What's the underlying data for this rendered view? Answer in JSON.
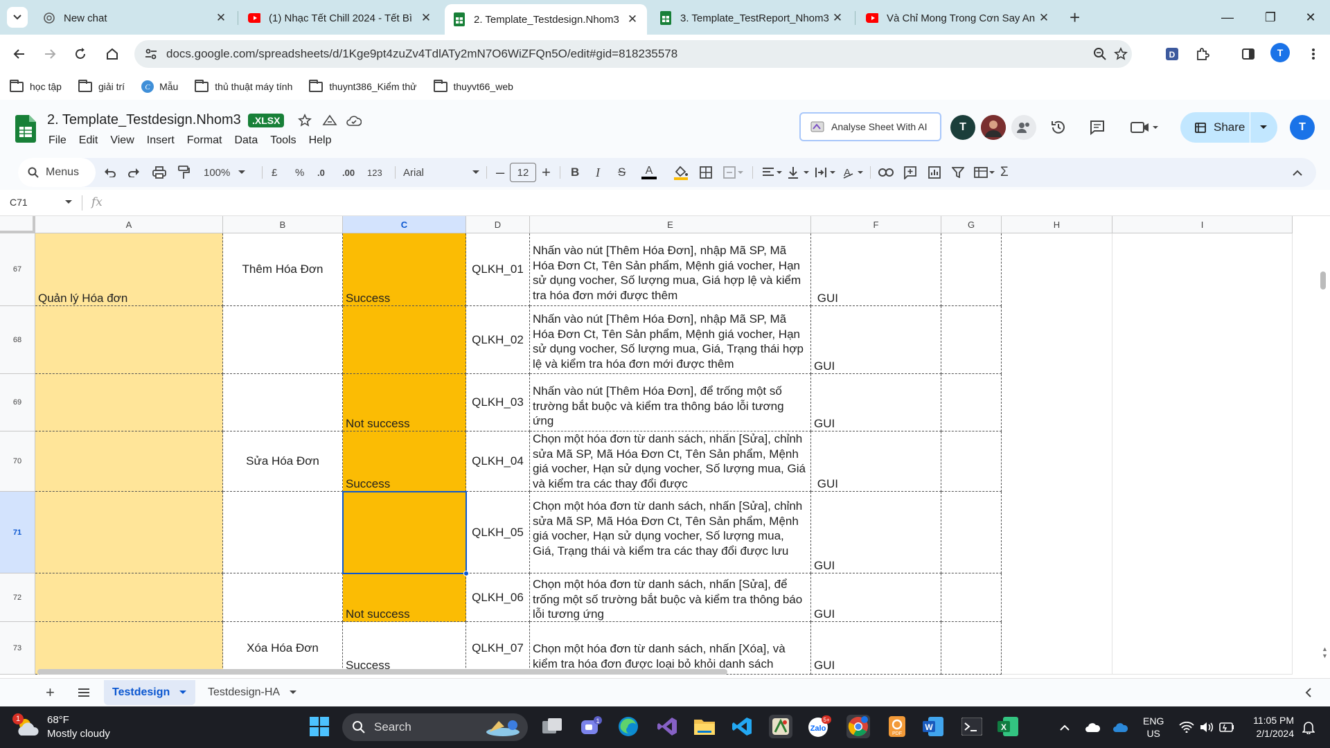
{
  "browser": {
    "tabs": [
      {
        "title": "New chat",
        "icon": "chat-icon"
      },
      {
        "title": "(1) Nhạc Tết Chill 2024 - Tết Bì",
        "icon": "youtube-icon"
      },
      {
        "title": "2. Template_Testdesign.Nhom3",
        "icon": "sheets-icon",
        "active": true
      },
      {
        "title": "3. Template_TestReport_Nhom3",
        "icon": "sheets-icon"
      },
      {
        "title": "Và Chỉ Mong Trong Cơn Say An",
        "icon": "youtube-icon"
      }
    ],
    "url": "docs.google.com/spreadsheets/d/1Kge9pt4zuZv4TdlATy2mN7O6WiZFQn5O/edit#gid=818235578",
    "bookmarks": [
      "học tập",
      "giải trí",
      "Mẫu",
      "thủ thuật máy tính",
      "thuynt386_Kiểm thử",
      "thuyvt66_web"
    ],
    "profile_initial": "T"
  },
  "sheets": {
    "doc_title": "2. Template_Testdesign.Nhom3",
    "file_badge": ".XLSX",
    "menu": [
      "File",
      "Edit",
      "View",
      "Insert",
      "Format",
      "Data",
      "Tools",
      "Help"
    ],
    "ai_button": "Analyse Sheet With AI",
    "share_label": "Share",
    "avatar_initial": "T",
    "toolbar": {
      "menus_label": "Menus",
      "zoom": "100%",
      "currency": "£",
      "percent": "%",
      "dec_decrease": ".0",
      "dec_increase": ".00",
      "number_format": "123",
      "font": "Arial",
      "font_size": "12"
    },
    "name_box": "C71",
    "fx_label": "fx",
    "columns": [
      "A",
      "B",
      "C",
      "D",
      "E",
      "F",
      "G",
      "H",
      "I"
    ],
    "selected_column": "C",
    "selected_row": "71",
    "rows": [
      {
        "num": "67",
        "a": "Quản lý Hóa đơn",
        "b": "Thêm Hóa Đơn",
        "c": "Success",
        "d": "QLKH_01",
        "e": "Nhấn vào nút [Thêm Hóa Đơn], nhập Mã SP, Mã Hóa Đơn Ct, Tên Sản phẩm, Mệnh giá vocher, Hạn sử dụng vocher, Số lượng mua, Giá hợp lệ và kiểm tra hóa đơn mới được thêm",
        "f": " GUI"
      },
      {
        "num": "68",
        "a": "",
        "b": "",
        "c": "",
        "d": "QLKH_02",
        "e": "Nhấn vào nút [Thêm Hóa Đơn], nhập Mã SP, Mã Hóa Đơn Ct, Tên Sản phẩm, Mệnh giá vocher, Hạn sử dụng vocher, Số lượng mua, Giá, Trạng thái hợp lệ và kiểm tra hóa đơn mới được thêm",
        "f": "GUI"
      },
      {
        "num": "69",
        "a": "",
        "b": "",
        "c": "Not success",
        "d": "QLKH_03",
        "e": "Nhấn vào nút [Thêm Hóa Đơn], để trống một số trường bắt buộc và kiểm tra thông báo lỗi tương ứng",
        "f": "GUI"
      },
      {
        "num": "70",
        "a": "",
        "b": "Sửa Hóa Đơn",
        "c": "Success",
        "d": "QLKH_04",
        "e": "Chọn một hóa đơn từ danh sách, nhấn [Sửa], chỉnh sửa Mã SP, Mã Hóa Đơn Ct, Tên Sản phẩm, Mệnh giá vocher, Hạn sử dụng vocher, Số lượng mua, Giá và kiểm tra các thay đổi được",
        "f": " GUI"
      },
      {
        "num": "71",
        "a": "",
        "b": "",
        "c": "",
        "d": "QLKH_05",
        "e": "Chọn một hóa đơn từ danh sách, nhấn [Sửa], chỉnh sửa Mã SP, Mã Hóa Đơn Ct, Tên Sản phẩm, Mệnh giá vocher, Hạn sử dụng vocher, Số lượng mua, Giá, Trạng thái và kiểm tra các thay đổi được lưu",
        "f": "GUI"
      },
      {
        "num": "72",
        "a": "",
        "b": "",
        "c": "Not success",
        "d": "QLKH_06",
        "e": " Chọn một hóa đơn từ danh sách, nhấn [Sửa], để trống một số trường bắt buộc và kiểm tra thông báo lỗi tương ứng",
        "f": "GUI"
      },
      {
        "num": "73",
        "a": "",
        "b": "Xóa Hóa Đơn",
        "c": "Success",
        "d": "QLKH_07",
        "e": "Chọn một hóa đơn từ danh sách, nhấn [Xóa], và kiểm tra hóa đơn được loại bỏ khỏi danh sách",
        "f": "GUI"
      }
    ],
    "sheet_tabs": [
      "Testdesign",
      "Testdesign-HA"
    ],
    "active_sheet": "Testdesign"
  },
  "taskbar": {
    "temperature": "68°F",
    "weather": "Mostly cloudy",
    "weather_badge": "1",
    "search_label": "Search",
    "lang_top": "ENG",
    "lang_bottom": "US",
    "time": "11:05 PM",
    "date": "2/1/2024"
  },
  "colors": {
    "col_a_fill": "#ffe599",
    "col_c_fill": "#fbbc04",
    "selection": "#0b57d0",
    "sheets_green": "#188038"
  }
}
